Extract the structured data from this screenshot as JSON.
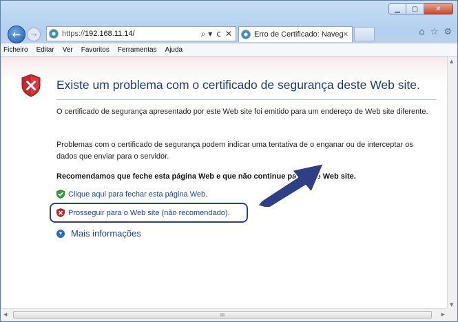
{
  "window": {
    "address_url_prefix": "https://",
    "address_url_host": "192.168.11.14/",
    "address_search_symbol": "⌕ ▾",
    "address_refresh_symbol": "ᴄ",
    "address_stop_symbol": "✕",
    "tab_title": "Erro de Certificado: Navega...",
    "tab_close_symbol": "✕",
    "back_symbol": "←",
    "forward_symbol": "→",
    "home_symbol": "⌂",
    "favorites_symbol": "☆",
    "tools_symbol": "⚙",
    "minimize_symbol": "▁",
    "maximize_symbol": "▢",
    "close_symbol": "✕"
  },
  "menubar": {
    "items": [
      "Ficheiro",
      "Editar",
      "Ver",
      "Favoritos",
      "Ferramentas",
      "Ajuda"
    ]
  },
  "page": {
    "heading": "Existe um problema com o certificado de segurança deste Web site.",
    "paragraph1": "O certificado de segurança apresentado por este Web site foi emitido para um endereço de Web site diferente.",
    "paragraph2": "Problemas com o certificado de segurança podem indicar uma tentativa de o enganar ou de interceptar os dados que enviar para o servidor.",
    "recommendation": "Recomendamos que feche esta página Web e que não continue para este Web site.",
    "close_link": "Clique aqui para fechar esta página Web.",
    "continue_link": "Prosseguir para o Web site (não recomendado).",
    "more_info": "Mais informações",
    "more_info_symbol": "▾"
  },
  "scrollbar": {
    "up_arrow": "▲",
    "down_arrow": "▼",
    "left_arrow": "◀",
    "right_arrow": "▶",
    "grip": "III"
  },
  "colors": {
    "heading": "#1f3a6e",
    "link": "#1a3f97",
    "highlight_box": "#2e3f86",
    "arrow": "#2e3f86",
    "shield_red": "#c8252c",
    "shield_green": "#3c9a3c"
  }
}
